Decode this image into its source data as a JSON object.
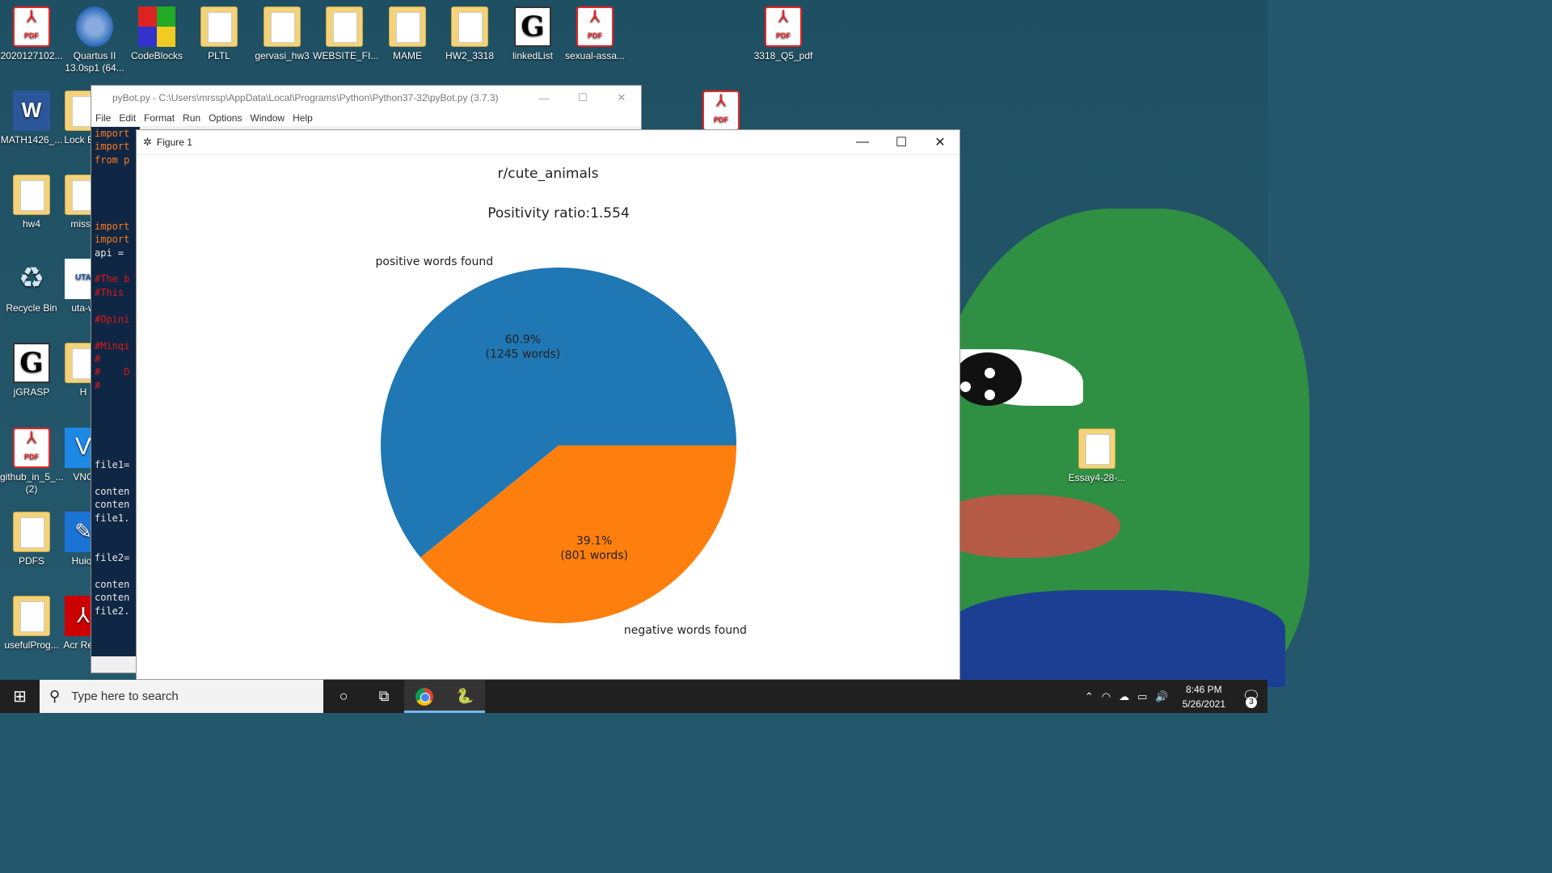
{
  "desktop": {
    "icons_top_row": [
      {
        "label": "2020127102...",
        "kind": "pdf"
      },
      {
        "label": "Quartus II 13.0sp1 (64...",
        "kind": "quartus"
      },
      {
        "label": "CodeBlocks",
        "kind": "codeblocks"
      },
      {
        "label": "PLTL",
        "kind": "folder"
      },
      {
        "label": "gervasi_hw3",
        "kind": "folder"
      },
      {
        "label": "WEBSITE_FI...",
        "kind": "folder"
      },
      {
        "label": "MAME",
        "kind": "folder"
      },
      {
        "label": "HW2_3318",
        "kind": "folder"
      },
      {
        "label": "linkedList",
        "kind": "jgrasp"
      },
      {
        "label": "sexual-assa...",
        "kind": "pdf"
      },
      {
        "label": "3318_Q5_pdf",
        "kind": "pdf"
      }
    ],
    "icons_left_col": [
      {
        "label": "MATH1426_...",
        "kind": "word"
      },
      {
        "label": "hw4",
        "kind": "folder"
      },
      {
        "label": "Recycle Bin",
        "kind": "recycle"
      },
      {
        "label": "jGRASP",
        "kind": "jgrasp"
      },
      {
        "label": "github_in_5_... (2)",
        "kind": "pdf"
      },
      {
        "label": "PDFS",
        "kind": "folder"
      },
      {
        "label": "usefulProg...",
        "kind": "folder"
      }
    ],
    "icons_second_col": [
      {
        "label": "Lock Bro",
        "kind": "lock"
      },
      {
        "label": "missir",
        "kind": "folder"
      },
      {
        "label": "uta-w",
        "kind": "uta"
      },
      {
        "label": "H",
        "kind": "folder"
      },
      {
        "label": "VNC",
        "kind": "vnc"
      },
      {
        "label": "Huior",
        "kind": "huion"
      },
      {
        "label": "Acr Reac",
        "kind": "acrobat"
      }
    ],
    "icon_right": {
      "label": "Essay4-28-...",
      "kind": "folder"
    },
    "icon_behind_window": {
      "kind": "pdf"
    }
  },
  "editor": {
    "title": "pyBot.py - C:\\Users\\mrssp\\AppData\\Local\\Programs\\Python\\Python37-32\\pyBot.py (3.7.3)",
    "menu": [
      "File",
      "Edit",
      "Format",
      "Run",
      "Options",
      "Window",
      "Help"
    ],
    "code_lines": [
      {
        "text": "import",
        "cls": "kw"
      },
      {
        "text": "import",
        "cls": "kw"
      },
      {
        "text": "from p",
        "cls": "kw"
      },
      {
        "text": "",
        "cls": ""
      },
      {
        "text": "",
        "cls": ""
      },
      {
        "text": "",
        "cls": ""
      },
      {
        "text": "",
        "cls": ""
      },
      {
        "text": "import",
        "cls": "kw"
      },
      {
        "text": "import",
        "cls": "kw"
      },
      {
        "text": "api =",
        "cls": ""
      },
      {
        "text": "",
        "cls": ""
      },
      {
        "text": "#The b",
        "cls": "cm"
      },
      {
        "text": "#This",
        "cls": "cm"
      },
      {
        "text": "",
        "cls": ""
      },
      {
        "text": "#Opini",
        "cls": "cm"
      },
      {
        "text": "",
        "cls": ""
      },
      {
        "text": "#Minqi",
        "cls": "cm"
      },
      {
        "text": "#",
        "cls": "cm"
      },
      {
        "text": "#    D",
        "cls": "cm"
      },
      {
        "text": "#",
        "cls": "cm"
      },
      {
        "text": "",
        "cls": ""
      },
      {
        "text": "",
        "cls": ""
      },
      {
        "text": "",
        "cls": ""
      },
      {
        "text": "",
        "cls": ""
      },
      {
        "text": "",
        "cls": ""
      },
      {
        "text": "file1=",
        "cls": ""
      },
      {
        "text": "",
        "cls": ""
      },
      {
        "text": "conten",
        "cls": ""
      },
      {
        "text": "conten",
        "cls": ""
      },
      {
        "text": "file1.",
        "cls": ""
      },
      {
        "text": "",
        "cls": ""
      },
      {
        "text": "",
        "cls": ""
      },
      {
        "text": "file2=",
        "cls": ""
      },
      {
        "text": "",
        "cls": ""
      },
      {
        "text": "conten",
        "cls": ""
      },
      {
        "text": "conten",
        "cls": ""
      },
      {
        "text": "file2.",
        "cls": ""
      }
    ]
  },
  "figure": {
    "title": "Figure 1",
    "minimize": "—",
    "maximize": "☐",
    "close": "✕"
  },
  "chart_data": {
    "type": "pie",
    "title": "r/cute_animals",
    "subtitle": "Positivity ratio:1.554",
    "slices": [
      {
        "label": "positive words found",
        "value": 1245,
        "percent_label": "60.9%",
        "count_label": "(1245 words)",
        "color": "#1f77b4"
      },
      {
        "label": "negative words found",
        "value": 801,
        "percent_label": "39.1%",
        "count_label": "(801 words)",
        "color": "#ff7f0e"
      }
    ]
  },
  "taskbar": {
    "search_placeholder": "Type here to search",
    "time": "8:46 PM",
    "date": "5/26/2021",
    "notification_count": "3"
  }
}
